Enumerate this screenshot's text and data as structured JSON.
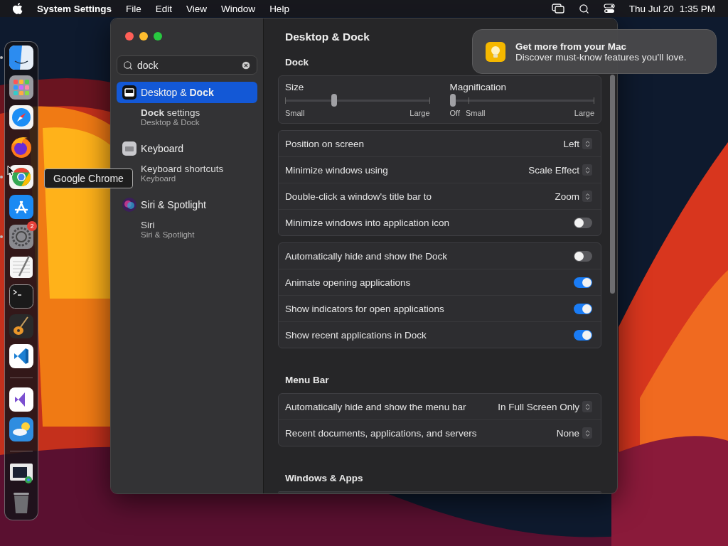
{
  "menu_bar": {
    "app": "System Settings",
    "menus": [
      "File",
      "Edit",
      "View",
      "Window",
      "Help"
    ],
    "date": "Thu Jul 20",
    "time": "1:35 PM"
  },
  "dock": {
    "items": [
      {
        "kind": "finder",
        "running": true
      },
      {
        "kind": "launchpad",
        "running": false
      },
      {
        "kind": "safari",
        "running": false
      },
      {
        "kind": "firefox",
        "running": false
      },
      {
        "kind": "chrome",
        "running": true
      },
      {
        "kind": "appstore",
        "running": false
      },
      {
        "kind": "settings",
        "running": true,
        "badge": "2"
      },
      {
        "kind": "textedit",
        "running": false
      },
      {
        "kind": "terminal",
        "running": false
      },
      {
        "kind": "garageband",
        "running": false
      },
      {
        "kind": "vscode",
        "running": false
      },
      {
        "kind": "separator"
      },
      {
        "kind": "visualstudio",
        "running": false
      },
      {
        "kind": "weather",
        "running": false
      },
      {
        "kind": "separator"
      },
      {
        "kind": "window",
        "running": false
      },
      {
        "kind": "trash",
        "running": false
      }
    ],
    "tooltip": "Google Chrome"
  },
  "sidebar": {
    "search": {
      "value": "dock"
    },
    "results": [
      {
        "kind": "desktop",
        "title": "Desktop & **Dock**",
        "selected": true,
        "children": [
          {
            "title": "**Dock** settings",
            "subtitle": "Desktop & Dock"
          }
        ]
      },
      {
        "kind": "keyboard",
        "title": "Keyboard",
        "selected": false,
        "children": [
          {
            "title": "Keyboard shortcuts",
            "subtitle": "Keyboard"
          }
        ]
      },
      {
        "kind": "siri",
        "title": "Siri & Spotlight",
        "selected": false,
        "children": [
          {
            "title": "Siri",
            "subtitle": "Siri & Spotlight"
          }
        ]
      }
    ]
  },
  "settings": {
    "title": "Desktop & Dock",
    "sections": [
      {
        "title": "Dock",
        "cards": [
          {
            "sliders": [
              {
                "label": "Size",
                "level": 0.33,
                "min_label": "Small",
                "max_label": "Large"
              },
              {
                "label": "Magnification",
                "level": 0,
                "min_label": "Off",
                "mid_label": "Small",
                "max_label": "Large"
              }
            ]
          },
          {
            "rows": [
              {
                "kind": "popup",
                "label": "Position on screen",
                "value": "Left"
              },
              {
                "kind": "popup",
                "label": "Minimize windows using",
                "value": "Scale Effect"
              },
              {
                "kind": "popup",
                "label": "Double-click a window's title bar to",
                "value": "Zoom"
              },
              {
                "kind": "toggle",
                "label": "Minimize windows into application icon",
                "on": false
              }
            ]
          },
          {
            "rows": [
              {
                "kind": "toggle",
                "label": "Automatically hide and show the Dock",
                "on": false
              },
              {
                "kind": "toggle",
                "label": "Animate opening applications",
                "on": true
              },
              {
                "kind": "toggle",
                "label": "Show indicators for open applications",
                "on": true
              },
              {
                "kind": "toggle",
                "label": "Show recent applications in Dock",
                "on": true
              }
            ]
          }
        ]
      },
      {
        "title": "Menu Bar",
        "cards": [
          {
            "rows": [
              {
                "kind": "popup",
                "label": "Automatically hide and show the menu bar",
                "value": "In Full Screen Only"
              },
              {
                "kind": "popup",
                "label": "Recent documents, applications, and servers",
                "value": "None"
              }
            ]
          }
        ]
      },
      {
        "title": "Windows & Apps"
      }
    ]
  },
  "notification": {
    "title": "Get more from your Mac",
    "body": "Discover must-know features you'll love."
  }
}
